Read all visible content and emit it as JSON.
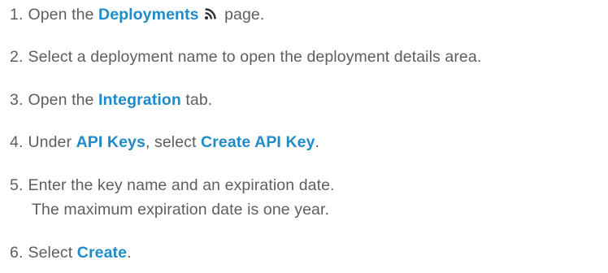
{
  "steps": [
    {
      "num": "1.",
      "pre": "Open the ",
      "ui": "Deployments",
      "icon": "rss-feed-icon",
      "post": " page."
    },
    {
      "num": "2.",
      "text": "Select a deployment name to open the deployment details area."
    },
    {
      "num": "3.",
      "pre": "Open the ",
      "ui": "Integration",
      "post": " tab."
    },
    {
      "num": "4.",
      "pre": "Under ",
      "ui": "API Keys",
      "mid": ", select ",
      "ui2": "Create API Key",
      "post": "."
    },
    {
      "num": "5.",
      "text": "Enter the key name and an expiration date.",
      "sub": "The maximum expiration date is one year."
    },
    {
      "num": "6.",
      "pre": "Select ",
      "ui": "Create",
      "post": "."
    }
  ],
  "colors": {
    "text": "#5e5e5e",
    "ui_label": "#1f8bc9"
  }
}
